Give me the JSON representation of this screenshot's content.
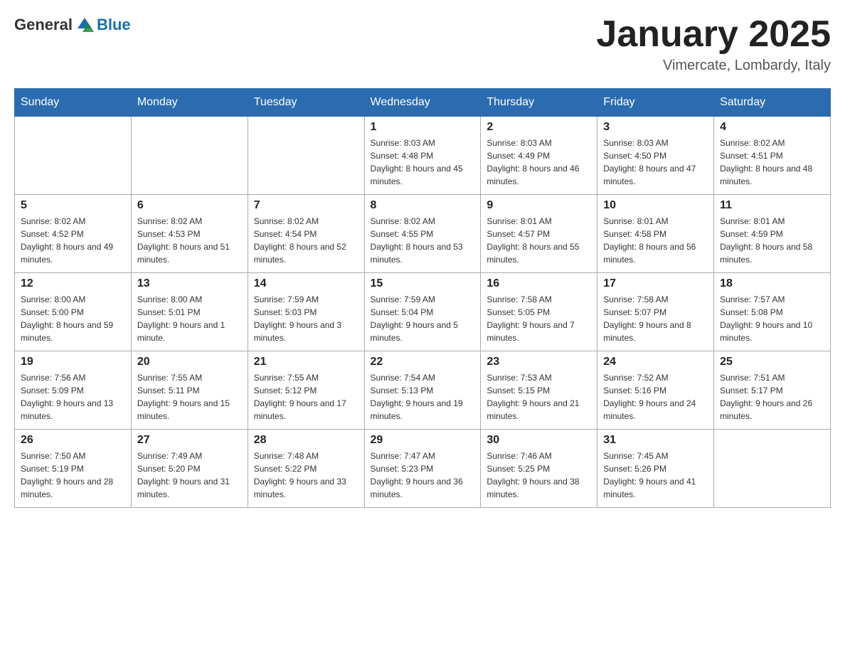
{
  "header": {
    "logo_general": "General",
    "logo_blue": "Blue",
    "month_title": "January 2025",
    "location": "Vimercate, Lombardy, Italy"
  },
  "weekdays": [
    "Sunday",
    "Monday",
    "Tuesday",
    "Wednesday",
    "Thursday",
    "Friday",
    "Saturday"
  ],
  "weeks": [
    [
      {
        "day": "",
        "info": ""
      },
      {
        "day": "",
        "info": ""
      },
      {
        "day": "",
        "info": ""
      },
      {
        "day": "1",
        "info": "Sunrise: 8:03 AM\nSunset: 4:48 PM\nDaylight: 8 hours and 45 minutes."
      },
      {
        "day": "2",
        "info": "Sunrise: 8:03 AM\nSunset: 4:49 PM\nDaylight: 8 hours and 46 minutes."
      },
      {
        "day": "3",
        "info": "Sunrise: 8:03 AM\nSunset: 4:50 PM\nDaylight: 8 hours and 47 minutes."
      },
      {
        "day": "4",
        "info": "Sunrise: 8:02 AM\nSunset: 4:51 PM\nDaylight: 8 hours and 48 minutes."
      }
    ],
    [
      {
        "day": "5",
        "info": "Sunrise: 8:02 AM\nSunset: 4:52 PM\nDaylight: 8 hours and 49 minutes."
      },
      {
        "day": "6",
        "info": "Sunrise: 8:02 AM\nSunset: 4:53 PM\nDaylight: 8 hours and 51 minutes."
      },
      {
        "day": "7",
        "info": "Sunrise: 8:02 AM\nSunset: 4:54 PM\nDaylight: 8 hours and 52 minutes."
      },
      {
        "day": "8",
        "info": "Sunrise: 8:02 AM\nSunset: 4:55 PM\nDaylight: 8 hours and 53 minutes."
      },
      {
        "day": "9",
        "info": "Sunrise: 8:01 AM\nSunset: 4:57 PM\nDaylight: 8 hours and 55 minutes."
      },
      {
        "day": "10",
        "info": "Sunrise: 8:01 AM\nSunset: 4:58 PM\nDaylight: 8 hours and 56 minutes."
      },
      {
        "day": "11",
        "info": "Sunrise: 8:01 AM\nSunset: 4:59 PM\nDaylight: 8 hours and 58 minutes."
      }
    ],
    [
      {
        "day": "12",
        "info": "Sunrise: 8:00 AM\nSunset: 5:00 PM\nDaylight: 8 hours and 59 minutes."
      },
      {
        "day": "13",
        "info": "Sunrise: 8:00 AM\nSunset: 5:01 PM\nDaylight: 9 hours and 1 minute."
      },
      {
        "day": "14",
        "info": "Sunrise: 7:59 AM\nSunset: 5:03 PM\nDaylight: 9 hours and 3 minutes."
      },
      {
        "day": "15",
        "info": "Sunrise: 7:59 AM\nSunset: 5:04 PM\nDaylight: 9 hours and 5 minutes."
      },
      {
        "day": "16",
        "info": "Sunrise: 7:58 AM\nSunset: 5:05 PM\nDaylight: 9 hours and 7 minutes."
      },
      {
        "day": "17",
        "info": "Sunrise: 7:58 AM\nSunset: 5:07 PM\nDaylight: 9 hours and 8 minutes."
      },
      {
        "day": "18",
        "info": "Sunrise: 7:57 AM\nSunset: 5:08 PM\nDaylight: 9 hours and 10 minutes."
      }
    ],
    [
      {
        "day": "19",
        "info": "Sunrise: 7:56 AM\nSunset: 5:09 PM\nDaylight: 9 hours and 13 minutes."
      },
      {
        "day": "20",
        "info": "Sunrise: 7:55 AM\nSunset: 5:11 PM\nDaylight: 9 hours and 15 minutes."
      },
      {
        "day": "21",
        "info": "Sunrise: 7:55 AM\nSunset: 5:12 PM\nDaylight: 9 hours and 17 minutes."
      },
      {
        "day": "22",
        "info": "Sunrise: 7:54 AM\nSunset: 5:13 PM\nDaylight: 9 hours and 19 minutes."
      },
      {
        "day": "23",
        "info": "Sunrise: 7:53 AM\nSunset: 5:15 PM\nDaylight: 9 hours and 21 minutes."
      },
      {
        "day": "24",
        "info": "Sunrise: 7:52 AM\nSunset: 5:16 PM\nDaylight: 9 hours and 24 minutes."
      },
      {
        "day": "25",
        "info": "Sunrise: 7:51 AM\nSunset: 5:17 PM\nDaylight: 9 hours and 26 minutes."
      }
    ],
    [
      {
        "day": "26",
        "info": "Sunrise: 7:50 AM\nSunset: 5:19 PM\nDaylight: 9 hours and 28 minutes."
      },
      {
        "day": "27",
        "info": "Sunrise: 7:49 AM\nSunset: 5:20 PM\nDaylight: 9 hours and 31 minutes."
      },
      {
        "day": "28",
        "info": "Sunrise: 7:48 AM\nSunset: 5:22 PM\nDaylight: 9 hours and 33 minutes."
      },
      {
        "day": "29",
        "info": "Sunrise: 7:47 AM\nSunset: 5:23 PM\nDaylight: 9 hours and 36 minutes."
      },
      {
        "day": "30",
        "info": "Sunrise: 7:46 AM\nSunset: 5:25 PM\nDaylight: 9 hours and 38 minutes."
      },
      {
        "day": "31",
        "info": "Sunrise: 7:45 AM\nSunset: 5:26 PM\nDaylight: 9 hours and 41 minutes."
      },
      {
        "day": "",
        "info": ""
      }
    ]
  ]
}
